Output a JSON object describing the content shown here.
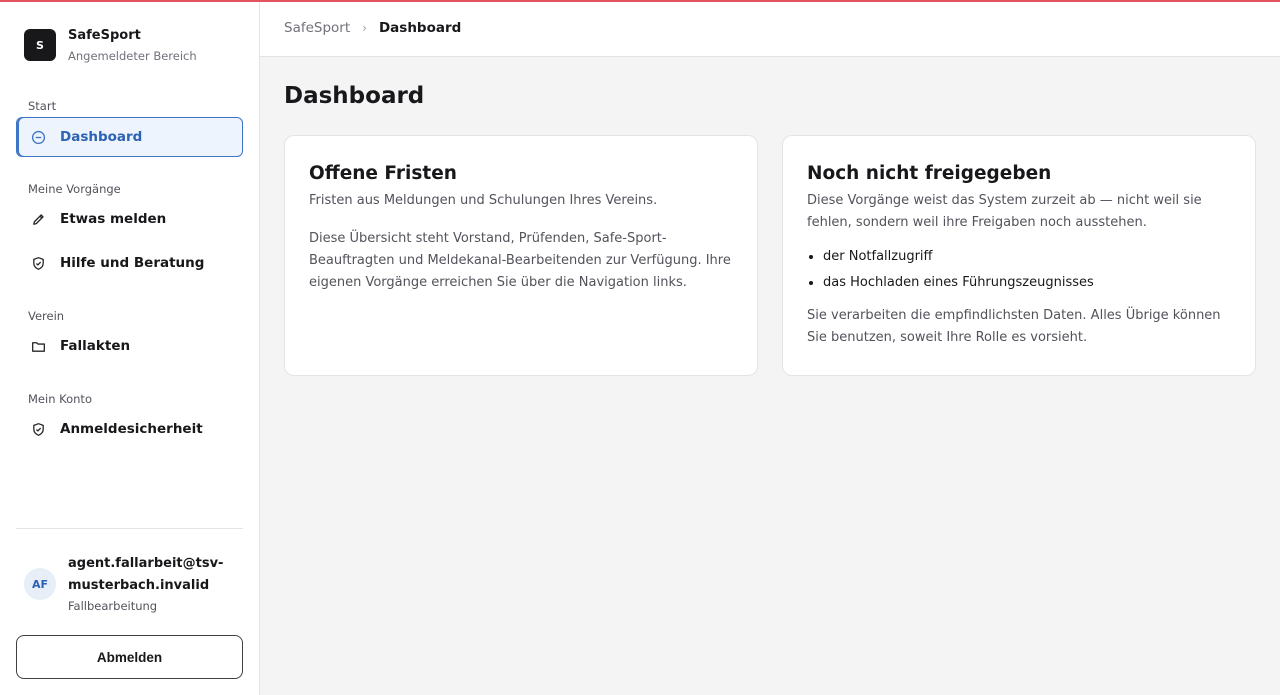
{
  "brand": {
    "logo_letter": "S",
    "title": "SafeSport",
    "subtitle": "Angemeldeter Bereich"
  },
  "sidebar": {
    "sections": [
      {
        "label": "Start",
        "items": [
          {
            "label": "Dashboard",
            "icon": "dashboard-icon",
            "active": true
          }
        ]
      },
      {
        "label": "Meine Vorgänge",
        "items": [
          {
            "label": "Etwas melden",
            "icon": "pencil-icon",
            "active": false
          },
          {
            "label": "Hilfe und Beratung",
            "icon": "shield-check-icon",
            "active": false
          }
        ]
      },
      {
        "label": "Verein",
        "items": [
          {
            "label": "Fallakten",
            "icon": "folder-icon",
            "active": false
          }
        ]
      },
      {
        "label": "Mein Konto",
        "items": [
          {
            "label": "Anmeldesicherheit",
            "icon": "shield-check-icon",
            "active": false
          }
        ]
      }
    ]
  },
  "user": {
    "initials": "AF",
    "email": "agent.fallarbeit@tsv-musterbach.invalid",
    "role": "Fallbearbeitung"
  },
  "logout_label": "Abmelden",
  "breadcrumb": {
    "root": "SafeSport",
    "separator": "›",
    "current": "Dashboard"
  },
  "page": {
    "title": "Dashboard"
  },
  "cards": [
    {
      "title": "Offene Fristen",
      "subtitle": "Fristen aus Meldungen und Schulungen Ihres Vereins.",
      "body": "Diese Übersicht steht Vorstand, Prüfenden, Safe-Sport-Beauftragten und Meldekanal-Bearbeitenden zur Verfügung. Ihre eigenen Vorgänge erreichen Sie über die Navigation links."
    },
    {
      "title": "Noch nicht freigegeben",
      "subtitle": "Diese Vorgänge weist das System zurzeit ab — nicht weil sie fehlen, sondern weil ihre Freigaben noch ausstehen.",
      "list": [
        "der Notfallzugriff",
        "das Hochladen eines Führungszeugnisses"
      ],
      "body": "Sie verarbeiten die empfindlichsten Daten. Alles Übrige können Sie benutzen, soweit Ihre Rolle es vorsieht."
    }
  ],
  "colors": {
    "accent": "#3f75c7",
    "top_border": "#e2555f",
    "background": "#f4f4f5"
  }
}
